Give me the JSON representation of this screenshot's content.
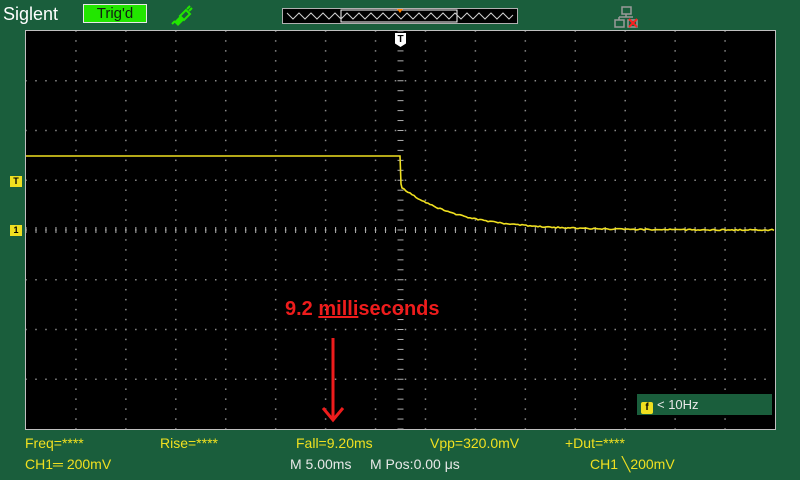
{
  "header": {
    "brand": "Siglent",
    "trigger_status": "Trig'd"
  },
  "markers": {
    "trigger_position": "T",
    "channel": "1",
    "trigger_level": "T"
  },
  "annotation": {
    "prefix": "9.2 ",
    "underlined": "milli",
    "suffix": "seconds"
  },
  "frequency_indicator": {
    "icon_letter": "f",
    "text": "< 10Hz"
  },
  "measurements": {
    "freq": "Freq=****",
    "rise": "Rise=****",
    "fall": "Fall=9.20ms",
    "vpp": "Vpp=320.0mV",
    "duty": "+Dut=****"
  },
  "status": {
    "ch1_scale": "CH1═ 200mV",
    "timebase": "M 5.00ms",
    "mpos": "M Pos:0.00 μs",
    "trigger": "CH1 ╲200mV"
  },
  "colors": {
    "background": "#1a5e3c",
    "trace": "#f0e020",
    "annotation": "#ee1c1c",
    "trigger_ok": "#22e600"
  },
  "icons": [
    "probe-icon",
    "network-disconnected-icon"
  ]
}
